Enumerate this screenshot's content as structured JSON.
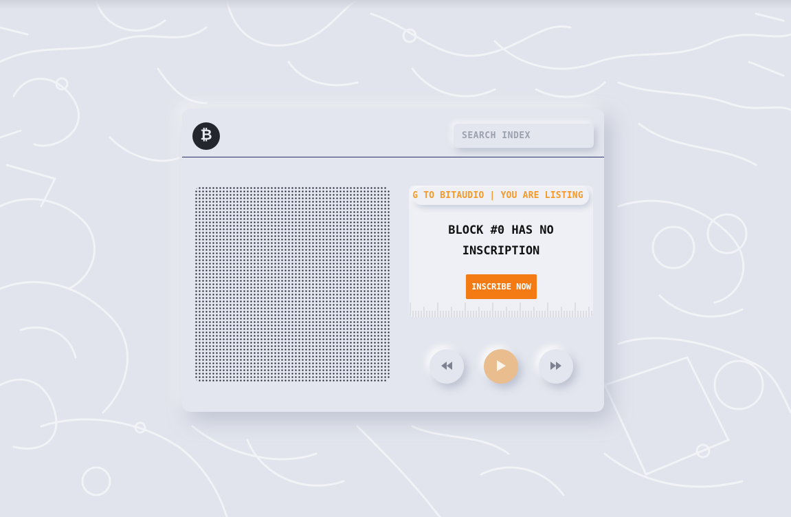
{
  "header": {
    "logo_icon": "bitcoin-icon",
    "search": {
      "placeholder": "SEARCH INDEX",
      "value": ""
    }
  },
  "screen": {
    "marquee_text": "NG TO BITAUDIO | YOU ARE LISTING TO BITAUDIO",
    "message_line1": "BLOCK #0 HAS NO",
    "message_line2": "INSCRIPTION",
    "inscribe_label": "INSCRIBE NOW"
  },
  "controls": {
    "rewind_icon": "rewind-icon",
    "play_icon": "play-icon",
    "forward_icon": "fast-forward-icon"
  },
  "colors": {
    "background": "#e1e4ec",
    "panel": "#e3e6ee",
    "accent_orange": "#f47a14",
    "marquee_orange": "#f59a2a",
    "play_button": "#e9bd8e",
    "divider": "#2d2f6b",
    "logo": "#23262d"
  }
}
